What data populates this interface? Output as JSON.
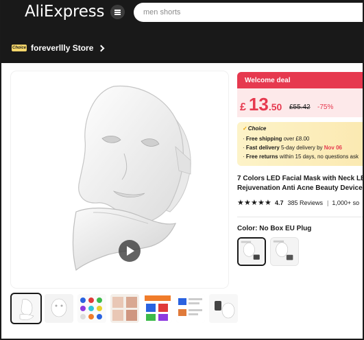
{
  "header": {
    "logo": "AliExpress",
    "search_placeholder": "men shorts",
    "store_badge": "Choice",
    "store_name": "foreverllly Store"
  },
  "gallery": {
    "main_image": "LED facial mask with neck piece, white",
    "thumbnail_count": 7,
    "selected_index": 0
  },
  "pricing": {
    "deal_label": "Welcome deal",
    "currency": "£",
    "price_int": "13",
    "price_dec": ".50",
    "original": "£55.42",
    "discount": "-75%"
  },
  "choice": {
    "title": "Choice",
    "shipping_label": "Free shipping",
    "shipping_text": "over £8.00",
    "delivery_label": "Fast delivery",
    "delivery_text": "5-day delivery by",
    "delivery_date": "Nov 06",
    "returns_label": "Free returns",
    "returns_text": "within 15 days, no questions ask"
  },
  "product": {
    "title_line1": "7 Colors LED Facial Mask with Neck LE",
    "title_line2": "Rejuvenation Anti Acne Beauty Device",
    "rating": "4.7",
    "reviews": "385 Reviews",
    "sold": "1,000+ so",
    "color_label": "Color: No Box EU Plug",
    "variant_count": 2
  },
  "colors": {
    "accent": "#e6394f",
    "header_bg": "#191919",
    "choice_bg": "#fbe9b1"
  }
}
